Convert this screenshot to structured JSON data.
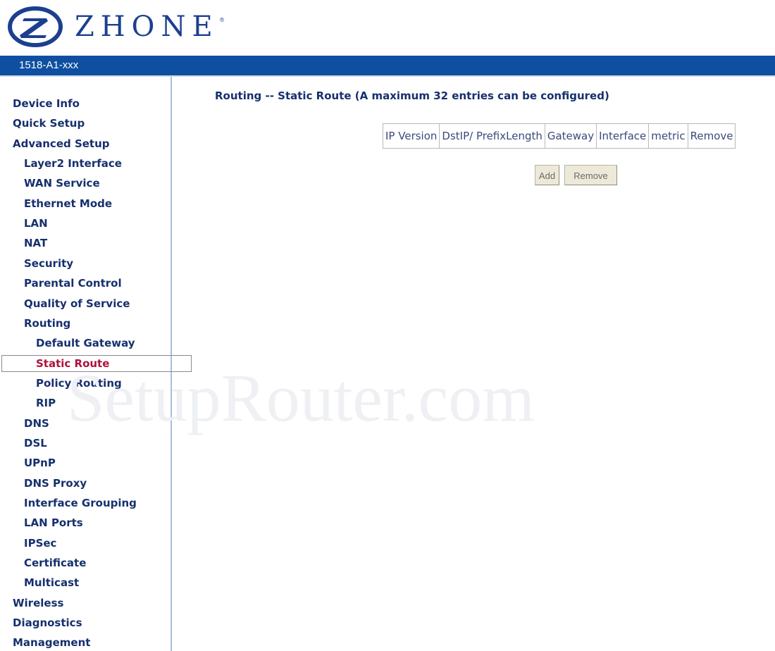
{
  "header": {
    "brand": "ZHONE",
    "registered_mark": "®",
    "model": "1518-A1-xxx",
    "colors": {
      "brand_blue": "#1c3f8f",
      "bar_blue": "#0e4fa2"
    }
  },
  "sidebar": {
    "items": [
      {
        "label": "Device Info",
        "level": 0
      },
      {
        "label": "Quick Setup",
        "level": 0
      },
      {
        "label": "Advanced Setup",
        "level": 0
      },
      {
        "label": "Layer2 Interface",
        "level": 1
      },
      {
        "label": "WAN Service",
        "level": 1
      },
      {
        "label": "Ethernet Mode",
        "level": 1
      },
      {
        "label": "LAN",
        "level": 1
      },
      {
        "label": "NAT",
        "level": 1
      },
      {
        "label": "Security",
        "level": 1
      },
      {
        "label": "Parental Control",
        "level": 1
      },
      {
        "label": "Quality of Service",
        "level": 1
      },
      {
        "label": "Routing",
        "level": 1
      },
      {
        "label": "Default Gateway",
        "level": 2
      },
      {
        "label": "Static Route",
        "level": 2,
        "active": true
      },
      {
        "label": "Policy Routing",
        "level": 2
      },
      {
        "label": "RIP",
        "level": 2
      },
      {
        "label": "DNS",
        "level": 1
      },
      {
        "label": "DSL",
        "level": 1
      },
      {
        "label": "UPnP",
        "level": 1
      },
      {
        "label": "DNS Proxy",
        "level": 1
      },
      {
        "label": "Interface Grouping",
        "level": 1
      },
      {
        "label": "LAN Ports",
        "level": 1
      },
      {
        "label": "IPSec",
        "level": 1
      },
      {
        "label": "Certificate",
        "level": 1
      },
      {
        "label": "Multicast",
        "level": 1
      },
      {
        "label": "Wireless",
        "level": 0
      },
      {
        "label": "Diagnostics",
        "level": 0
      },
      {
        "label": "Management",
        "level": 0
      }
    ]
  },
  "main": {
    "title": "Routing -- Static Route (A maximum 32 entries can be configured)",
    "table": {
      "columns": [
        "IP Version",
        "DstIP/ PrefixLength",
        "Gateway",
        "Interface",
        "metric",
        "Remove"
      ],
      "rows": []
    },
    "buttons": {
      "add": "Add",
      "remove": "Remove"
    }
  },
  "watermark": "SetupRouter.com"
}
